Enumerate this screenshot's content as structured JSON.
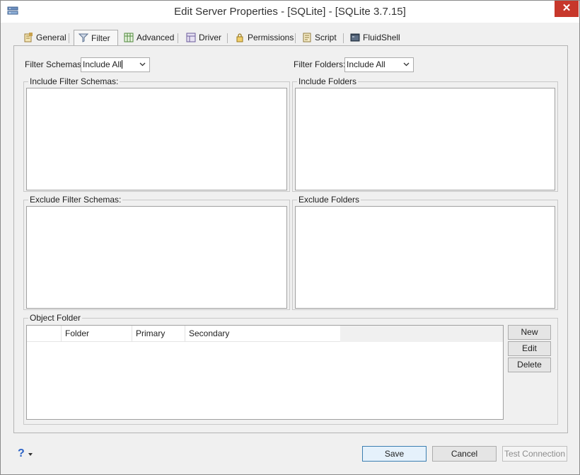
{
  "window": {
    "title": "Edit Server Properties - [SQLite] - [SQLite 3.7.15]",
    "close_label": "✕"
  },
  "tabs": [
    {
      "label": "General",
      "icon": "general-icon"
    },
    {
      "label": "Filter",
      "icon": "filter-icon",
      "active": true
    },
    {
      "label": "Advanced",
      "icon": "advanced-icon"
    },
    {
      "label": "Driver",
      "icon": "driver-icon"
    },
    {
      "label": "Permissions",
      "icon": "permissions-icon"
    },
    {
      "label": "Script",
      "icon": "script-icon"
    },
    {
      "label": "FluidShell",
      "icon": "fluidshell-icon"
    }
  ],
  "filter": {
    "schemas_label": "Filter Schemas:",
    "schemas_value": "Include All",
    "folders_label": "Filter Folders:",
    "folders_value": "Include All"
  },
  "groups": {
    "include_schemas": "Include Filter Schemas:",
    "include_folders": "Include Folders",
    "exclude_schemas": "Exclude Filter Schemas:",
    "exclude_folders": "Exclude Folders",
    "object_folder": "Object Folder"
  },
  "object_table": {
    "columns": [
      "",
      "Folder",
      "Primary",
      "Secondary"
    ]
  },
  "object_buttons": {
    "new": "New",
    "edit": "Edit",
    "delete": "Delete"
  },
  "footer": {
    "help": "?",
    "save": "Save",
    "cancel": "Cancel",
    "test_connection": "Test Connection"
  },
  "colors": {
    "close": "#c7372b",
    "help": "#2b62c6",
    "primary_button_border": "#3c7fb1"
  }
}
